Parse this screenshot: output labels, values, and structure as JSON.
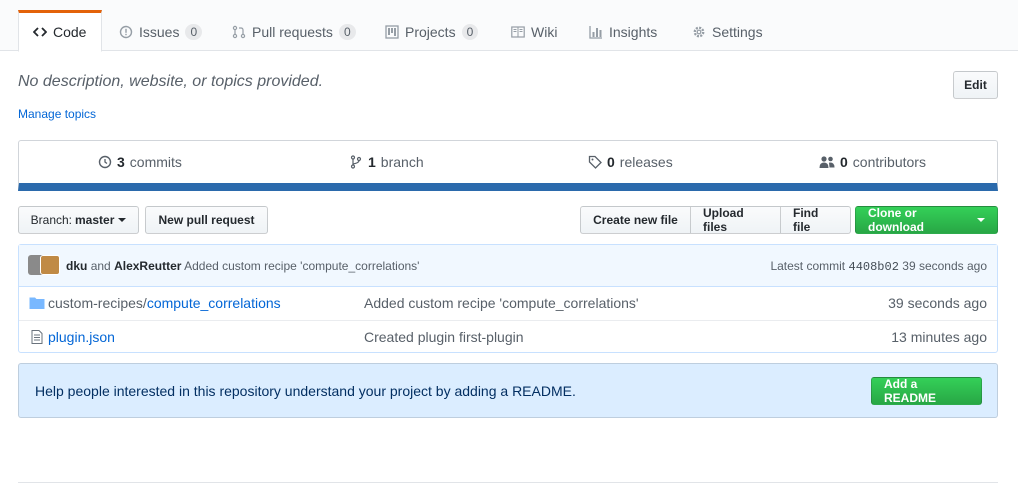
{
  "tabs": [
    {
      "label": "Code",
      "count": null,
      "selected": true,
      "icon": "code-icon"
    },
    {
      "label": "Issues",
      "count": "0",
      "icon": "issue-icon"
    },
    {
      "label": "Pull requests",
      "count": "0",
      "icon": "pull-request-icon"
    },
    {
      "label": "Projects",
      "count": "0",
      "icon": "project-icon"
    },
    {
      "label": "Wiki",
      "count": null,
      "icon": "book-icon"
    },
    {
      "label": "Insights",
      "count": null,
      "icon": "graph-icon"
    },
    {
      "label": "Settings",
      "count": null,
      "icon": "gear-icon"
    }
  ],
  "repo": {
    "description": "No description, website, or topics provided.",
    "manage_topics": "Manage topics",
    "edit_label": "Edit"
  },
  "summary": {
    "commits": {
      "num": "3",
      "label": "commits"
    },
    "branches": {
      "num": "1",
      "label": "branch"
    },
    "releases": {
      "num": "0",
      "label": "releases"
    },
    "contributors": {
      "num": "0",
      "label": "contributors"
    }
  },
  "filenav": {
    "branch_prefix": "Branch:",
    "branch_name": "master",
    "new_pr": "New pull request",
    "create_file": "Create new file",
    "upload_files": "Upload files",
    "find_file": "Find file",
    "clone": "Clone or download"
  },
  "commit_tease": {
    "author1": "dku",
    "and": "and",
    "author2": "AlexReutter",
    "message": "Added custom recipe 'compute_correlations'",
    "latest_label": "Latest commit",
    "sha": "4408b02",
    "age": "39 seconds ago"
  },
  "files": [
    {
      "type": "directory",
      "prefix": "custom-recipes/",
      "name": "compute_correlations",
      "message": "Added custom recipe 'compute_correlations'",
      "age": "39 seconds ago"
    },
    {
      "type": "file",
      "prefix": "",
      "name": "plugin.json",
      "message": "Created plugin first-plugin",
      "age": "13 minutes ago"
    }
  ],
  "readme_prompt": {
    "text": "Help people interested in this repository understand your project by adding a README.",
    "button": "Add a README"
  },
  "colors": {
    "accent_tab": "#e36209",
    "language_bar": "#2b6aac",
    "primary_button": "#28a745",
    "link": "#0366d6"
  }
}
